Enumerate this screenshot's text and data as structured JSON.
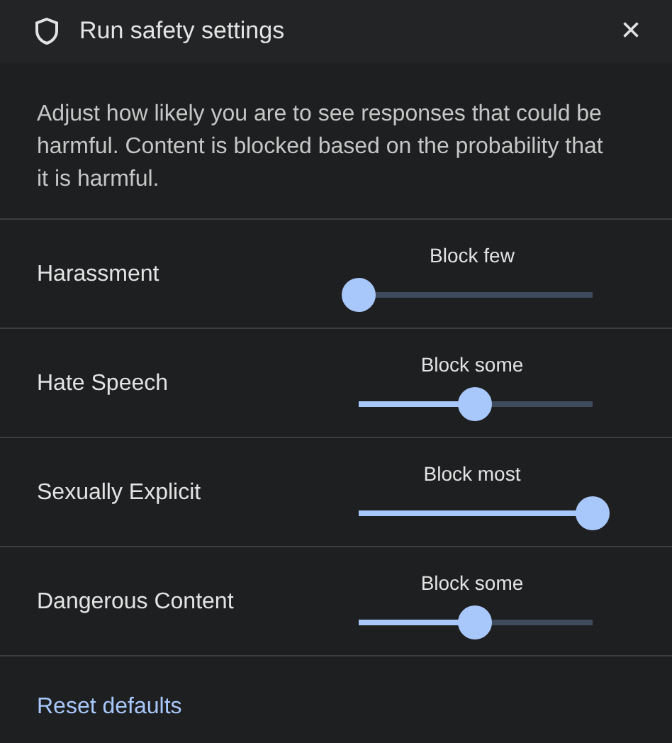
{
  "dialog": {
    "title": "Run safety settings",
    "close": "×"
  },
  "description": "Adjust how likely you are to see responses that could be harmful. Content is blocked based on the probability that it is harmful.",
  "settings": [
    {
      "name": "Harassment",
      "reading": "Block few",
      "level": 0
    },
    {
      "name": "Hate Speech",
      "reading": "Block some",
      "level": 0.5
    },
    {
      "name": "Sexually Explicit",
      "reading": "Block most",
      "level": 1
    },
    {
      "name": "Dangerous Content",
      "reading": "Block some",
      "level": 0.5
    }
  ],
  "reset_link": "Reset defaults"
}
